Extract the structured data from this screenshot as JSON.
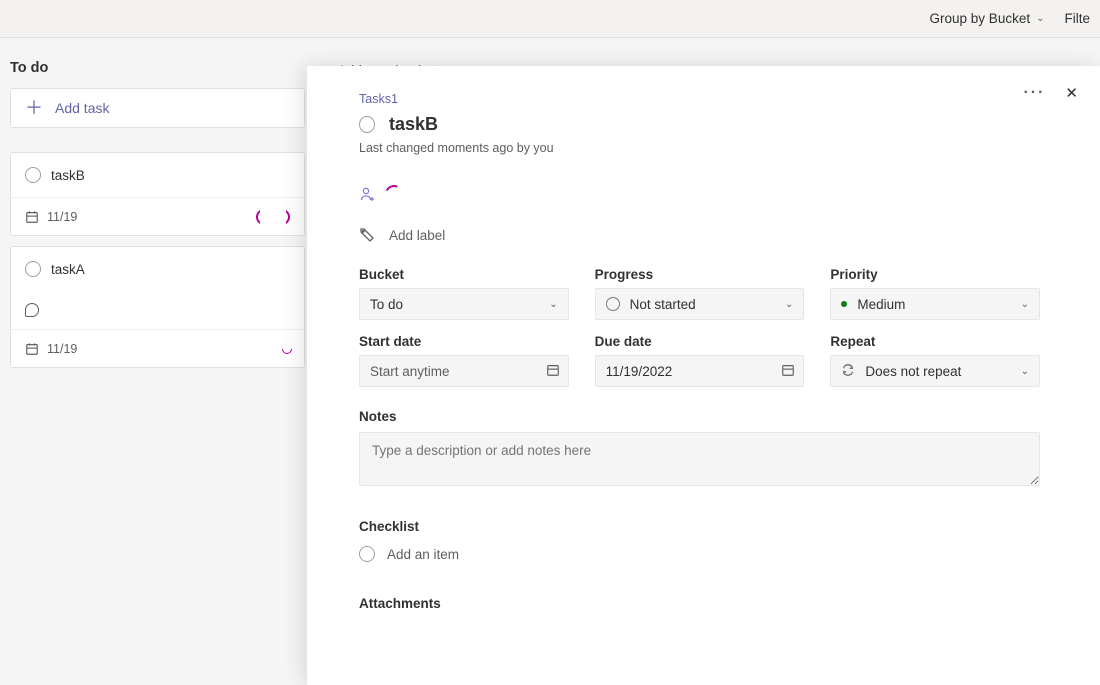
{
  "toolbar": {
    "group_by_label": "Group by Bucket",
    "filter_label": "Filte"
  },
  "bucket": {
    "title": "To do",
    "add_task_label": "Add task",
    "cards": [
      {
        "title": "taskB",
        "date": "11/19"
      },
      {
        "title": "taskA",
        "date": "11/19"
      }
    ]
  },
  "add_bucket_label": "Add new bucket",
  "panel": {
    "plan_name": "Tasks1",
    "task_title": "taskB",
    "last_changed": "Last changed moments ago by you",
    "add_label_text": "Add label",
    "fields": {
      "bucket_label": "Bucket",
      "bucket_value": "To do",
      "progress_label": "Progress",
      "progress_value": "Not started",
      "priority_label": "Priority",
      "priority_value": "Medium",
      "start_date_label": "Start date",
      "start_date_placeholder": "Start anytime",
      "due_date_label": "Due date",
      "due_date_value": "11/19/2022",
      "repeat_label": "Repeat",
      "repeat_value": "Does not repeat"
    },
    "notes_label": "Notes",
    "notes_placeholder": "Type a description or add notes here",
    "checklist_label": "Checklist",
    "checklist_placeholder": "Add an item",
    "attachments_label": "Attachments"
  }
}
